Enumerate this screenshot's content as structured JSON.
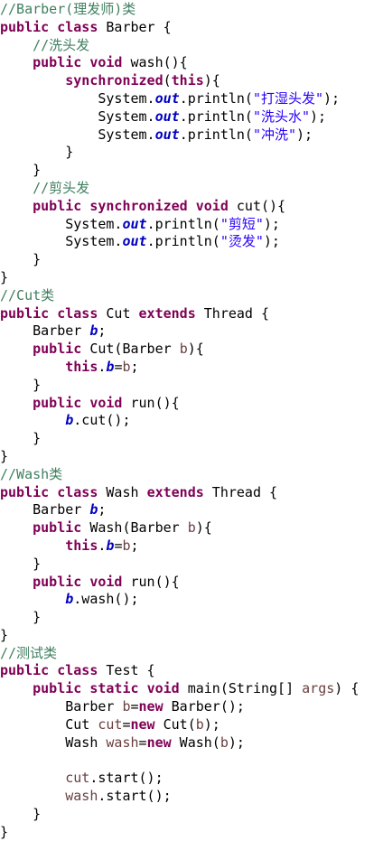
{
  "editor": {
    "colors": {
      "comment": "#3f7f5f",
      "keyword": "#7f0055",
      "field": "#0000c0",
      "string": "#2a00ff",
      "param": "#6a3e3e",
      "plain": "#000000",
      "background": "#ffffff"
    },
    "lines": [
      [
        {
          "t": "//Barber(理发师)类",
          "k": "comment"
        }
      ],
      [
        {
          "t": "public",
          "k": "keyword"
        },
        {
          "t": " "
        },
        {
          "t": "class",
          "k": "keyword"
        },
        {
          "t": " Barber {"
        }
      ],
      [
        {
          "t": "    "
        },
        {
          "t": "//洗头发",
          "k": "comment"
        }
      ],
      [
        {
          "t": "    "
        },
        {
          "t": "public",
          "k": "keyword"
        },
        {
          "t": " "
        },
        {
          "t": "void",
          "k": "keyword"
        },
        {
          "t": " wash(){"
        }
      ],
      [
        {
          "t": "        "
        },
        {
          "t": "synchronized",
          "k": "keyword"
        },
        {
          "t": "("
        },
        {
          "t": "this",
          "k": "keyword"
        },
        {
          "t": "){"
        }
      ],
      [
        {
          "t": "            System."
        },
        {
          "t": "out",
          "k": "field"
        },
        {
          "t": ".println("
        },
        {
          "t": "\"打湿头发\"",
          "k": "string"
        },
        {
          "t": ");"
        }
      ],
      [
        {
          "t": "            System."
        },
        {
          "t": "out",
          "k": "field"
        },
        {
          "t": ".println("
        },
        {
          "t": "\"洗头水\"",
          "k": "string"
        },
        {
          "t": ");"
        }
      ],
      [
        {
          "t": "            System."
        },
        {
          "t": "out",
          "k": "field"
        },
        {
          "t": ".println("
        },
        {
          "t": "\"冲洗\"",
          "k": "string"
        },
        {
          "t": ");"
        }
      ],
      [
        {
          "t": "        }"
        }
      ],
      [
        {
          "t": "    }"
        }
      ],
      [
        {
          "t": "    "
        },
        {
          "t": "//剪头发",
          "k": "comment"
        }
      ],
      [
        {
          "t": "    "
        },
        {
          "t": "public",
          "k": "keyword"
        },
        {
          "t": " "
        },
        {
          "t": "synchronized",
          "k": "keyword"
        },
        {
          "t": " "
        },
        {
          "t": "void",
          "k": "keyword"
        },
        {
          "t": " cut(){"
        }
      ],
      [
        {
          "t": "        System."
        },
        {
          "t": "out",
          "k": "field"
        },
        {
          "t": ".println("
        },
        {
          "t": "\"剪短\"",
          "k": "string"
        },
        {
          "t": ");"
        }
      ],
      [
        {
          "t": "        System."
        },
        {
          "t": "out",
          "k": "field"
        },
        {
          "t": ".println("
        },
        {
          "t": "\"烫发\"",
          "k": "string"
        },
        {
          "t": ");"
        }
      ],
      [
        {
          "t": "    }"
        }
      ],
      [
        {
          "t": "}"
        }
      ],
      [
        {
          "t": "//Cut类",
          "k": "comment"
        }
      ],
      [
        {
          "t": "public",
          "k": "keyword"
        },
        {
          "t": " "
        },
        {
          "t": "class",
          "k": "keyword"
        },
        {
          "t": " Cut "
        },
        {
          "t": "extends",
          "k": "keyword"
        },
        {
          "t": " Thread {"
        }
      ],
      [
        {
          "t": "    Barber "
        },
        {
          "t": "b",
          "k": "field"
        },
        {
          "t": ";"
        }
      ],
      [
        {
          "t": "    "
        },
        {
          "t": "public",
          "k": "keyword"
        },
        {
          "t": " Cut(Barber "
        },
        {
          "t": "b",
          "k": "param"
        },
        {
          "t": "){"
        }
      ],
      [
        {
          "t": "        "
        },
        {
          "t": "this",
          "k": "keyword"
        },
        {
          "t": "."
        },
        {
          "t": "b",
          "k": "field"
        },
        {
          "t": "="
        },
        {
          "t": "b",
          "k": "param"
        },
        {
          "t": ";"
        }
      ],
      [
        {
          "t": "    }"
        }
      ],
      [
        {
          "t": "    "
        },
        {
          "t": "public",
          "k": "keyword"
        },
        {
          "t": " "
        },
        {
          "t": "void",
          "k": "keyword"
        },
        {
          "t": " run(){"
        }
      ],
      [
        {
          "t": "        "
        },
        {
          "t": "b",
          "k": "field"
        },
        {
          "t": ".cut();"
        }
      ],
      [
        {
          "t": "    }"
        }
      ],
      [
        {
          "t": "}"
        }
      ],
      [
        {
          "t": "//Wash类",
          "k": "comment"
        }
      ],
      [
        {
          "t": "public",
          "k": "keyword"
        },
        {
          "t": " "
        },
        {
          "t": "class",
          "k": "keyword"
        },
        {
          "t": " Wash "
        },
        {
          "t": "extends",
          "k": "keyword"
        },
        {
          "t": " Thread {"
        }
      ],
      [
        {
          "t": "    Barber "
        },
        {
          "t": "b",
          "k": "field"
        },
        {
          "t": ";"
        }
      ],
      [
        {
          "t": "    "
        },
        {
          "t": "public",
          "k": "keyword"
        },
        {
          "t": " Wash(Barber "
        },
        {
          "t": "b",
          "k": "param"
        },
        {
          "t": "){"
        }
      ],
      [
        {
          "t": "        "
        },
        {
          "t": "this",
          "k": "keyword"
        },
        {
          "t": "."
        },
        {
          "t": "b",
          "k": "field"
        },
        {
          "t": "="
        },
        {
          "t": "b",
          "k": "param"
        },
        {
          "t": ";"
        }
      ],
      [
        {
          "t": "    }"
        }
      ],
      [
        {
          "t": "    "
        },
        {
          "t": "public",
          "k": "keyword"
        },
        {
          "t": " "
        },
        {
          "t": "void",
          "k": "keyword"
        },
        {
          "t": " run(){"
        }
      ],
      [
        {
          "t": "        "
        },
        {
          "t": "b",
          "k": "field"
        },
        {
          "t": ".wash();"
        }
      ],
      [
        {
          "t": "    }"
        }
      ],
      [
        {
          "t": "}"
        }
      ],
      [
        {
          "t": "//测试类",
          "k": "comment"
        }
      ],
      [
        {
          "t": "public",
          "k": "keyword"
        },
        {
          "t": " "
        },
        {
          "t": "class",
          "k": "keyword"
        },
        {
          "t": " Test {"
        }
      ],
      [
        {
          "t": "    "
        },
        {
          "t": "public",
          "k": "keyword"
        },
        {
          "t": " "
        },
        {
          "t": "static",
          "k": "keyword"
        },
        {
          "t": " "
        },
        {
          "t": "void",
          "k": "keyword"
        },
        {
          "t": " main(String[] "
        },
        {
          "t": "args",
          "k": "param"
        },
        {
          "t": ") {"
        }
      ],
      [
        {
          "t": "        Barber "
        },
        {
          "t": "b",
          "k": "local"
        },
        {
          "t": "="
        },
        {
          "t": "new",
          "k": "keyword"
        },
        {
          "t": " Barber();"
        }
      ],
      [
        {
          "t": "        Cut "
        },
        {
          "t": "cut",
          "k": "local"
        },
        {
          "t": "="
        },
        {
          "t": "new",
          "k": "keyword"
        },
        {
          "t": " Cut("
        },
        {
          "t": "b",
          "k": "local"
        },
        {
          "t": ");"
        }
      ],
      [
        {
          "t": "        Wash "
        },
        {
          "t": "wash",
          "k": "local"
        },
        {
          "t": "="
        },
        {
          "t": "new",
          "k": "keyword"
        },
        {
          "t": " Wash("
        },
        {
          "t": "b",
          "k": "local"
        },
        {
          "t": ");"
        }
      ],
      [],
      [
        {
          "t": "        "
        },
        {
          "t": "cut",
          "k": "local"
        },
        {
          "t": ".start();"
        }
      ],
      [
        {
          "t": "        "
        },
        {
          "t": "wash",
          "k": "local"
        },
        {
          "t": ".start();"
        }
      ],
      [
        {
          "t": "    }"
        }
      ],
      [
        {
          "t": "}"
        }
      ]
    ]
  }
}
